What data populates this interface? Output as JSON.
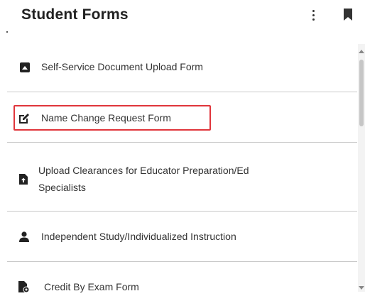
{
  "header": {
    "title": "Student Forms",
    "menu_icon": "more-vert-icon",
    "bookmark_icon": "bookmark-icon"
  },
  "forms": [
    {
      "label": "Self-Service Document Upload Form",
      "icon": "upload-box-icon"
    },
    {
      "label": "Name Change Request Form",
      "icon": "edit-icon",
      "highlighted": true
    },
    {
      "label_line1": "Upload Clearances for Educator Preparation/Ed",
      "label_line2": "Specialists",
      "icon": "file-upload-icon"
    },
    {
      "label": "Independent Study/Individualized Instruction",
      "icon": "person-icon"
    },
    {
      "label": "Credit By Exam Form",
      "icon": "file-settings-icon"
    }
  ],
  "colors": {
    "highlight_border": "#e0353b",
    "divider": "#c9c9c9",
    "icon": "#222222"
  }
}
